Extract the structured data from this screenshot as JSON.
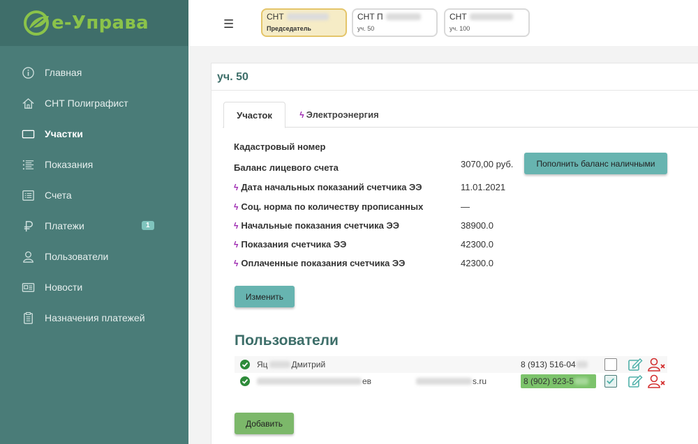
{
  "app": {
    "logo_text": "е-Управа",
    "brand_color": "#8bc34a",
    "sidebar_color": "#4a7c78"
  },
  "sidebar": {
    "items": [
      {
        "label": "Главная",
        "icon": "info-icon"
      },
      {
        "label": "СНТ Полиграфист",
        "icon": "home-icon"
      },
      {
        "label": "Участки",
        "icon": "plot-icon",
        "active": true
      },
      {
        "label": "Показания",
        "icon": "list-icon"
      },
      {
        "label": "Счета",
        "icon": "invoice-icon"
      },
      {
        "label": "Платежи",
        "icon": "ruble-icon",
        "badge": "1"
      },
      {
        "label": "Пользователи",
        "icon": "user-icon"
      },
      {
        "label": "Новости",
        "icon": "news-icon"
      },
      {
        "label": "Назначения платежей",
        "icon": "clipboard-icon"
      }
    ]
  },
  "topbar": {
    "menu_icon": "hamburger-icon",
    "snt_tabs": [
      {
        "name": "СНТ",
        "sub": "Председатель",
        "active": true
      },
      {
        "name": "СНТ П",
        "sub": "уч. 50"
      },
      {
        "name": "СНТ",
        "sub": "уч. 100"
      }
    ]
  },
  "plot": {
    "title": "уч. 50",
    "tabs": [
      {
        "label": "Участок"
      },
      {
        "label": "Электроэнергия"
      }
    ],
    "fields": [
      {
        "label": "Кадастровый номер",
        "value": "",
        "bolt": false
      },
      {
        "label": "Баланс лицевого счета",
        "value": "3070,00 руб.",
        "bolt": false
      },
      {
        "label": "Дата начальных показаний счетчика ЭЭ",
        "value": "11.01.2021",
        "bolt": true
      },
      {
        "label": "Соц. норма по количеству прописанных",
        "value": "—",
        "bolt": true
      },
      {
        "label": "Начальные показания счетчика ЭЭ",
        "value": "38900.0",
        "bolt": true
      },
      {
        "label": "Показания счетчика ЭЭ",
        "value": "42300.0",
        "bolt": true
      },
      {
        "label": "Оплаченные показания счетчика ЭЭ",
        "value": "42300.0",
        "bolt": true
      }
    ],
    "topup_button": "Пополнить баланс наличными",
    "edit_button": "Изменить"
  },
  "users": {
    "title": "Пользователи",
    "rows": [
      {
        "name_start": "Яц",
        "name_end": "Дмитрий",
        "email": "",
        "phone": "8 (913) 516-04",
        "checked": false
      },
      {
        "name_start": "",
        "name_end": "ев",
        "email": "s.ru",
        "phone": "8 (902) 923-5",
        "checked": true,
        "highlight": true
      }
    ],
    "add_button": "Добавить"
  }
}
